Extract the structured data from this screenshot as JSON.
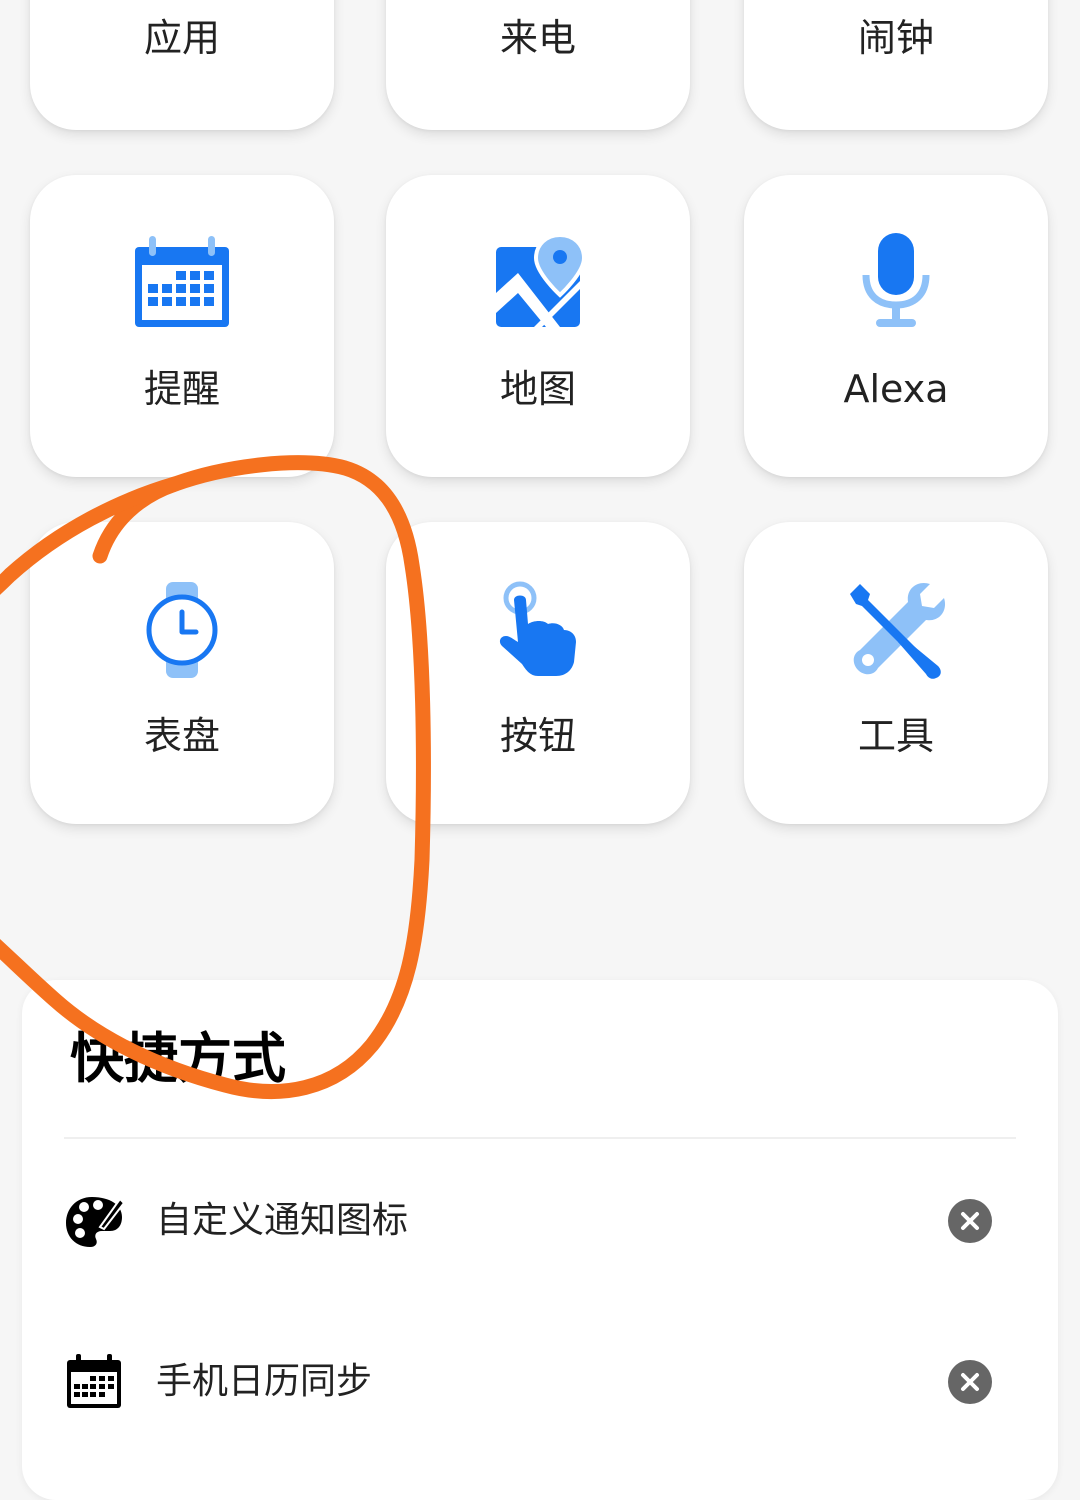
{
  "features": {
    "top_row": [
      {
        "label": "应用"
      },
      {
        "label": "来电"
      },
      {
        "label": "闹钟"
      }
    ],
    "row2": [
      {
        "label": "提醒",
        "icon": "calendar-icon"
      },
      {
        "label": "地图",
        "icon": "map-pin-icon"
      },
      {
        "label": "Alexa",
        "icon": "microphone-icon"
      }
    ],
    "row3": [
      {
        "label": "表盘",
        "icon": "watch-face-icon"
      },
      {
        "label": "按钮",
        "icon": "tap-finger-icon"
      },
      {
        "label": "工具",
        "icon": "tools-icon"
      }
    ]
  },
  "shortcuts": {
    "title": "快捷方式",
    "items": [
      {
        "label": "自定义通知图标",
        "icon": "palette-icon",
        "action_icon": "remove-icon"
      },
      {
        "label": "手机日历同步",
        "icon": "calendar-icon",
        "action_icon": "remove-icon"
      }
    ]
  },
  "colors": {
    "icon_blue": "#1877f2",
    "icon_light_blue": "#8ec1f8",
    "annotation_orange": "#f5711f",
    "remove_button": "#666666"
  }
}
